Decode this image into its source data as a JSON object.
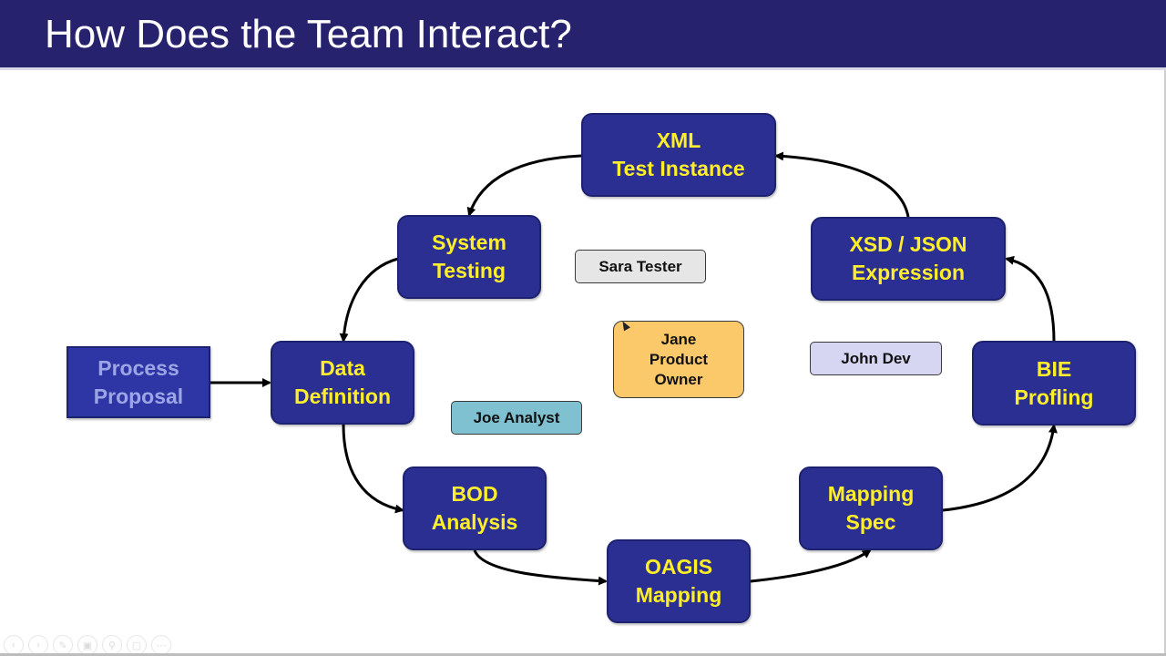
{
  "slide": {
    "title": "How Does the Team Interact?",
    "colors": {
      "header": "#27226e",
      "step_fill": "#2a2f91",
      "step_text": "#ffef2a",
      "proposal_text": "#9ca6e6"
    }
  },
  "steps": [
    {
      "id": "process-proposal",
      "lines": [
        "Process",
        "Proposal"
      ]
    },
    {
      "id": "data-definition",
      "lines": [
        "Data",
        "Definition"
      ]
    },
    {
      "id": "bod-analysis",
      "lines": [
        "BOD",
        "Analysis"
      ]
    },
    {
      "id": "oagis-mapping",
      "lines": [
        "OAGIS",
        "Mapping"
      ]
    },
    {
      "id": "mapping-spec",
      "lines": [
        "Mapping",
        "Spec"
      ]
    },
    {
      "id": "bie-profiling",
      "lines": [
        "BIE",
        "Profling"
      ]
    },
    {
      "id": "xsd-json-expression",
      "lines": [
        "XSD / JSON",
        "Expression"
      ]
    },
    {
      "id": "xml-test-instance",
      "lines": [
        "XML",
        "Test Instance"
      ]
    },
    {
      "id": "system-testing",
      "lines": [
        "System",
        "Testing"
      ]
    }
  ],
  "flow": [
    [
      "process-proposal",
      "data-definition"
    ],
    [
      "data-definition",
      "bod-analysis"
    ],
    [
      "bod-analysis",
      "oagis-mapping"
    ],
    [
      "oagis-mapping",
      "mapping-spec"
    ],
    [
      "mapping-spec",
      "bie-profiling"
    ],
    [
      "bie-profiling",
      "xsd-json-expression"
    ],
    [
      "xsd-json-expression",
      "xml-test-instance"
    ],
    [
      "xml-test-instance",
      "system-testing"
    ],
    [
      "system-testing",
      "data-definition"
    ]
  ],
  "roles": [
    {
      "id": "sara",
      "lines": [
        "Sara Tester"
      ],
      "color": "#e6e6e6"
    },
    {
      "id": "jane",
      "lines": [
        "Jane",
        "Product",
        "Owner"
      ],
      "color": "#fcc96a"
    },
    {
      "id": "john",
      "lines": [
        "John Dev"
      ],
      "color": "#d6d6f2"
    },
    {
      "id": "joe",
      "lines": [
        "Joe Analyst"
      ],
      "color": "#7fc1d0"
    }
  ],
  "toolbar": [
    "previous-icon",
    "next-icon",
    "pen-icon",
    "slides-icon",
    "zoom-icon",
    "screen-icon",
    "more-icon"
  ]
}
